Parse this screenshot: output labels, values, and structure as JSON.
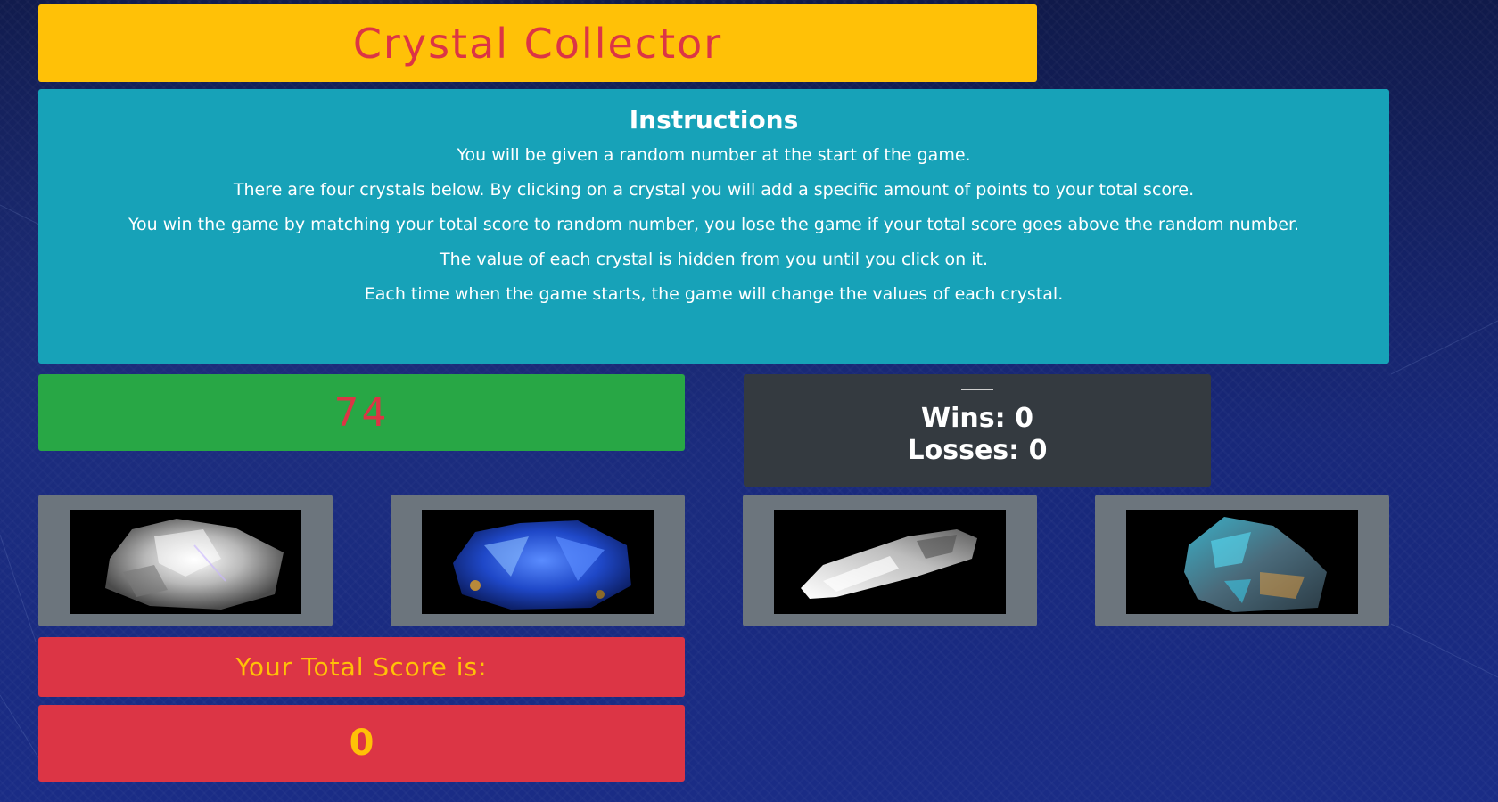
{
  "header": {
    "title": "Crystal Collector"
  },
  "instructions": {
    "heading": "Instructions",
    "lines": [
      "You will be given a random number at the start of the game.",
      "There are four crystals below. By clicking on a crystal you will add a specific amount of points to your total score.",
      "You win the game by matching your total score to random number, you lose the game if your total score goes above the random number.",
      "The value of each crystal is hidden from you until you click on it.",
      "Each time when the game starts, the game will change the values of each crystal."
    ]
  },
  "game": {
    "random_number": "74",
    "stats": {
      "wins_text": "Wins: 0",
      "losses_text": "Losses: 0"
    },
    "crystals": [
      {
        "icon": "clear-quartz-crystal-icon"
      },
      {
        "icon": "blue-azurite-crystal-icon"
      },
      {
        "icon": "clear-quartz-point-crystal-icon"
      },
      {
        "icon": "labradorite-crystal-icon"
      }
    ],
    "score_label": "Your Total Score is:",
    "total_score": "0"
  },
  "colors": {
    "title_bg": "#ffc107",
    "title_text": "#dc3545",
    "instructions_bg": "#17a2b8",
    "target_bg": "#28a745",
    "stats_bg": "#343a40",
    "crystal_card_bg": "#6c757d",
    "score_bg": "#dc3545",
    "score_text": "#ffc107"
  }
}
